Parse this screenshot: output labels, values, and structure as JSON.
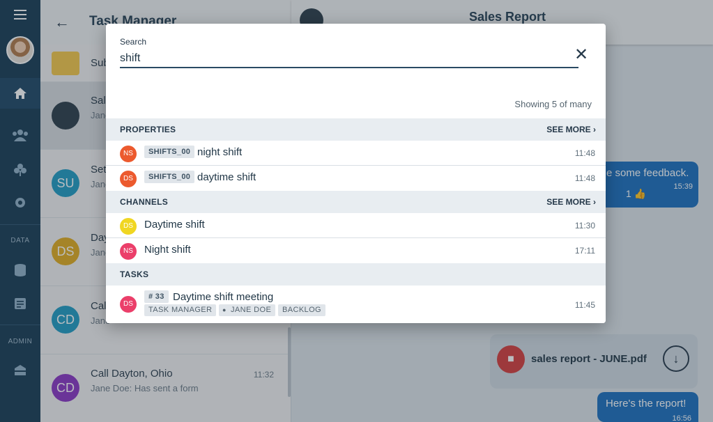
{
  "rail": {
    "sections": [
      "DATA",
      "ADMIN"
    ],
    "icons": [
      "menu-icon",
      "home-icon",
      "people-icon",
      "club-icon",
      "gear-icon",
      "database-icon",
      "document-icon",
      "admin-icon"
    ]
  },
  "list": {
    "title": "Task Manager",
    "rows": [
      {
        "avatar": "",
        "name": "Sub",
        "sub": "",
        "time": ""
      },
      {
        "avatar": "",
        "name": "Sale",
        "sub": "Jane",
        "time": ""
      },
      {
        "avatar": "SU",
        "name": "Set",
        "sub": "Jane",
        "time": "",
        "color": "#1f9bc3"
      },
      {
        "avatar": "DS",
        "name": "Day",
        "sub": "Jane",
        "time": "",
        "color": "#e0ac1f"
      },
      {
        "avatar": "CD",
        "name": "Call",
        "sub": "Jane",
        "time": "",
        "color": "#1f9bc3"
      },
      {
        "avatar": "CD",
        "name": "Call Dayton, Ohio",
        "sub": "Jane Doe: Has sent a form",
        "time": "11:32",
        "color": "#8a35c4"
      }
    ]
  },
  "chat": {
    "title": "Sales Report",
    "feedback_text": "e some feedback.",
    "feedback_reaction": "1 👍",
    "feedback_time": "15:39",
    "file_name": "sales report - JUNE.pdf",
    "report_text": "Here's the report!",
    "report_time": "16:56"
  },
  "search": {
    "label": "Search",
    "value": "shift",
    "showing": "Showing 5 of many",
    "properties_title": "PROPERTIES",
    "channels_title": "CHANNELS",
    "tasks_title": "TASKS",
    "see_more": "SEE MORE",
    "properties": [
      {
        "avatar": "NS",
        "color": "#ec5a2e",
        "tag": "SHIFTS_00",
        "name": "night shift",
        "time": "11:48"
      },
      {
        "avatar": "DS",
        "color": "#ec5a2e",
        "tag": "SHIFTS_00",
        "name": "daytime shift",
        "time": "11:48"
      }
    ],
    "channels": [
      {
        "avatar": "DS",
        "color": "#f0d622",
        "name": "Daytime shift",
        "time": "11:30"
      },
      {
        "avatar": "NS",
        "color": "#eb3f6a",
        "name": "Night shift",
        "time": "17:11"
      }
    ],
    "tasks": [
      {
        "avatar": "DS",
        "color": "#eb3f6a",
        "tag": "# 33",
        "name": "Daytime shift meeting",
        "time": "11:45",
        "chips": [
          "TASK MANAGER",
          "JANE DOE",
          "BACKLOG"
        ]
      }
    ]
  }
}
